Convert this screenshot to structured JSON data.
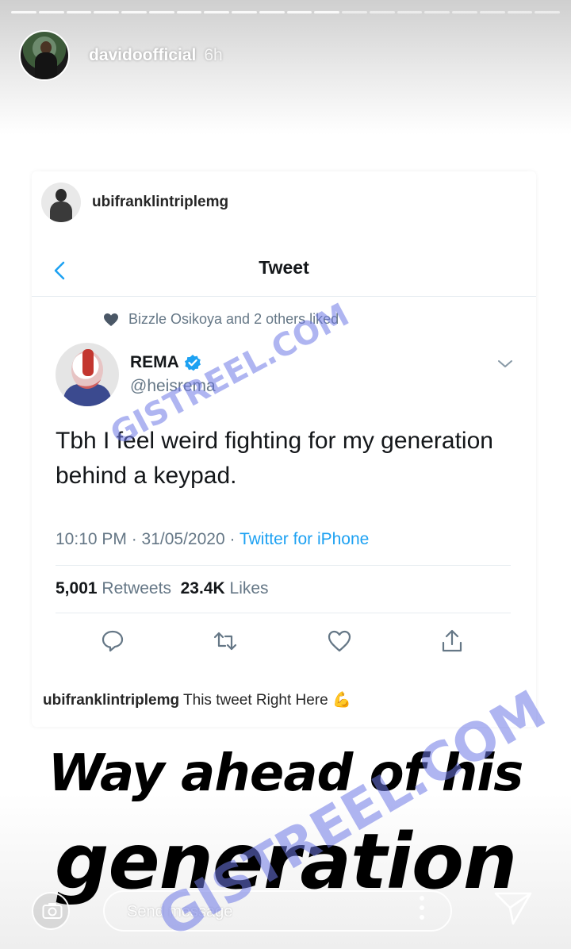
{
  "story": {
    "progress_segments": 20,
    "username": "davidoofficial",
    "time": "6h"
  },
  "post": {
    "sharer": "ubifranklintriplemg",
    "tweet_screen": {
      "title": "Tweet",
      "liked_by": "Bizzle Osikoya and 2 others liked",
      "author_name": "REMA",
      "author_handle": "@heisrema",
      "text": "Tbh I feel weird fighting for my generation behind a keypad.",
      "timestamp": "10:10 PM · 31/05/2020 · ",
      "source": "Twitter for iPhone",
      "retweets_count": "5,001",
      "retweets_label": "Retweets",
      "likes_count": "23.4K",
      "likes_label": "Likes"
    },
    "caption_user": "ubifranklintriplemg",
    "caption_text": "This tweet Right Here 💪"
  },
  "overlay": {
    "line1": "Way ahead of his",
    "line2": "generation"
  },
  "watermarks": {
    "top": "GISTREEL.COM",
    "bottom": "GISTREEL.COM"
  },
  "reply": {
    "placeholder": "Send message"
  },
  "colors": {
    "twitter_blue": "#1da1f2",
    "back_arrow": "#1da1f2",
    "watermark": "#6e78e6"
  }
}
